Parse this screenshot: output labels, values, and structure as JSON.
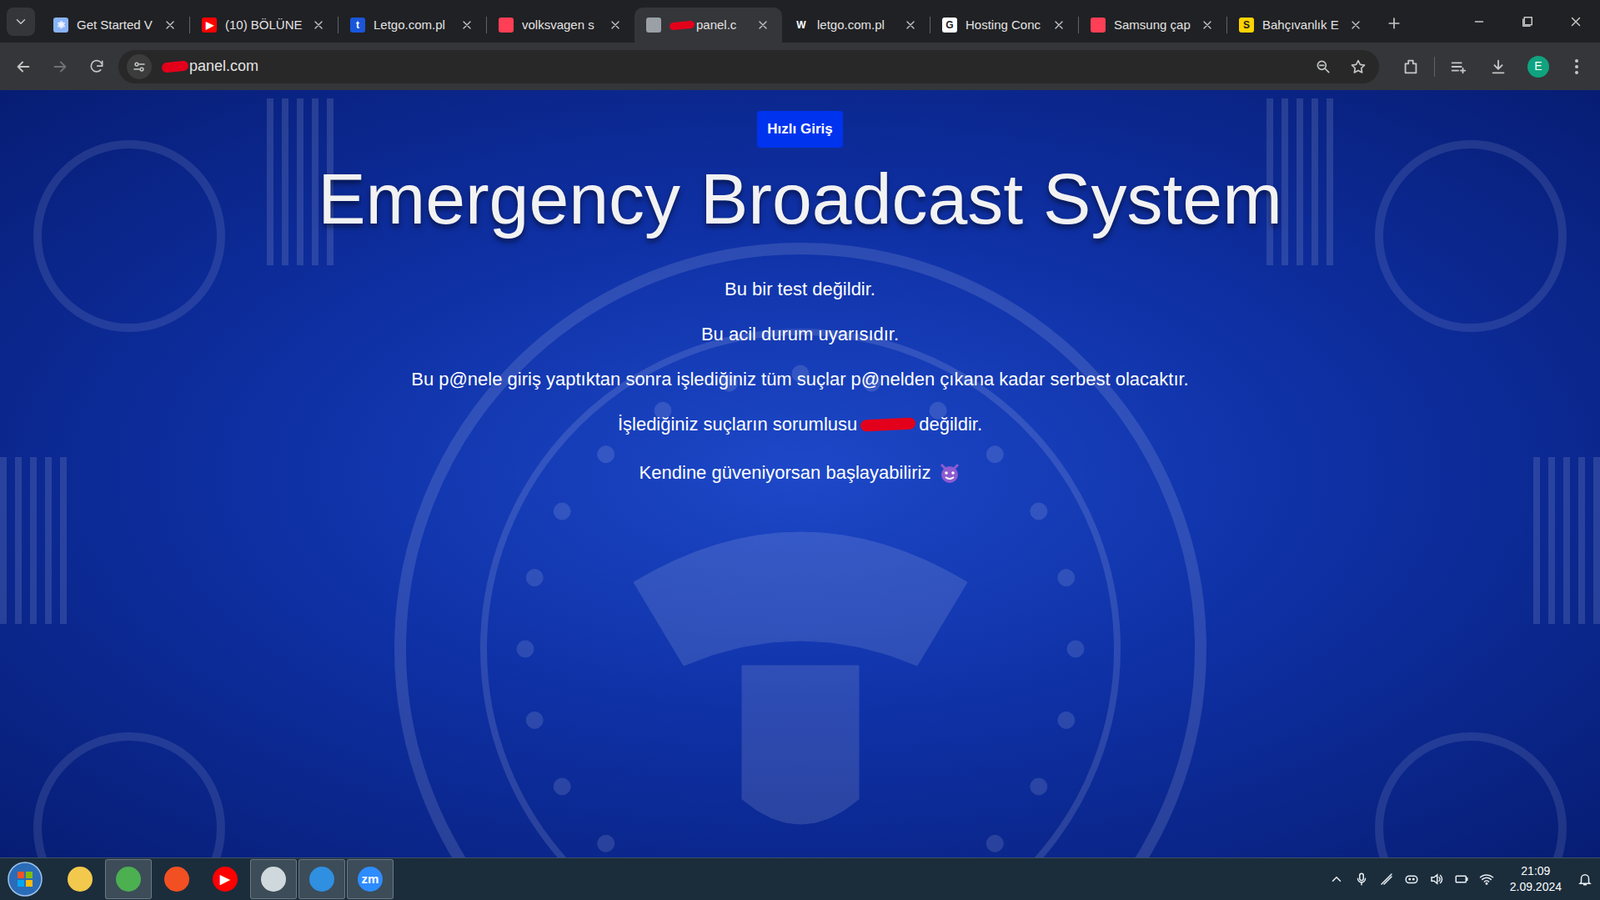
{
  "browser": {
    "tabs": [
      {
        "label": "Get Started V",
        "selected": false,
        "glyph": "⚛",
        "color": "#8ab4f8"
      },
      {
        "label": "(10) BÖLÜNE",
        "selected": false,
        "glyph": "▶",
        "color": "#ff0000"
      },
      {
        "label": "Letgo.com.pl",
        "selected": false,
        "glyph": "t",
        "color": "#1a56db"
      },
      {
        "label": "volksvagen s",
        "selected": false,
        "glyph": "",
        "color": "#ff3f55"
      },
      {
        "label": "panel.c",
        "selected": true,
        "glyph": "",
        "color": "#9aa0a6"
      },
      {
        "label": "letgo.com.pl",
        "selected": false,
        "glyph": "W",
        "color": "#202124"
      },
      {
        "label": "Hosting Conc",
        "selected": false,
        "glyph": "G",
        "color": "#ffffff"
      },
      {
        "label": "Samsung çap",
        "selected": false,
        "glyph": "",
        "color": "#ff3f55"
      },
      {
        "label": "Bahçıvanlık E",
        "selected": false,
        "glyph": "S",
        "color": "#ffd400"
      }
    ],
    "address": "panel.com",
    "profile": "E"
  },
  "page": {
    "button": "Hızlı Giriş",
    "title": "Emergency Broadcast System",
    "lines": [
      "Bu bir test değildir.",
      "Bu acil durum uyarısıdır.",
      "Bu p@nele giriş yaptıktan sonra işlediğiniz tüm suçlar p@nelden çıkana kadar serbest olacaktır."
    ],
    "responsibility": {
      "before": "İşlediğiniz suçların sorumlusu",
      "after": "değildir."
    },
    "closing": "Kendine güveniyorsan başlayabiliriz"
  },
  "taskbar": {
    "apps": [
      {
        "name": "explorer",
        "running": false,
        "glyph": "",
        "color": "#f2c94c"
      },
      {
        "name": "chrome",
        "running": true,
        "glyph": "",
        "color": "#4caf50"
      },
      {
        "name": "store",
        "running": false,
        "glyph": "",
        "color": "#f25022"
      },
      {
        "name": "youtube-music",
        "running": false,
        "glyph": "▶",
        "color": "#ff0000"
      },
      {
        "name": "obs",
        "running": true,
        "glyph": "",
        "color": "#cfd8dc"
      },
      {
        "name": "vscode",
        "running": true,
        "glyph": "",
        "color": "#2f8fe0"
      },
      {
        "name": "zoom",
        "running": true,
        "glyph": "zm",
        "color": "#2d8cff"
      }
    ],
    "time": "21:09",
    "date": "2.09.2024"
  }
}
